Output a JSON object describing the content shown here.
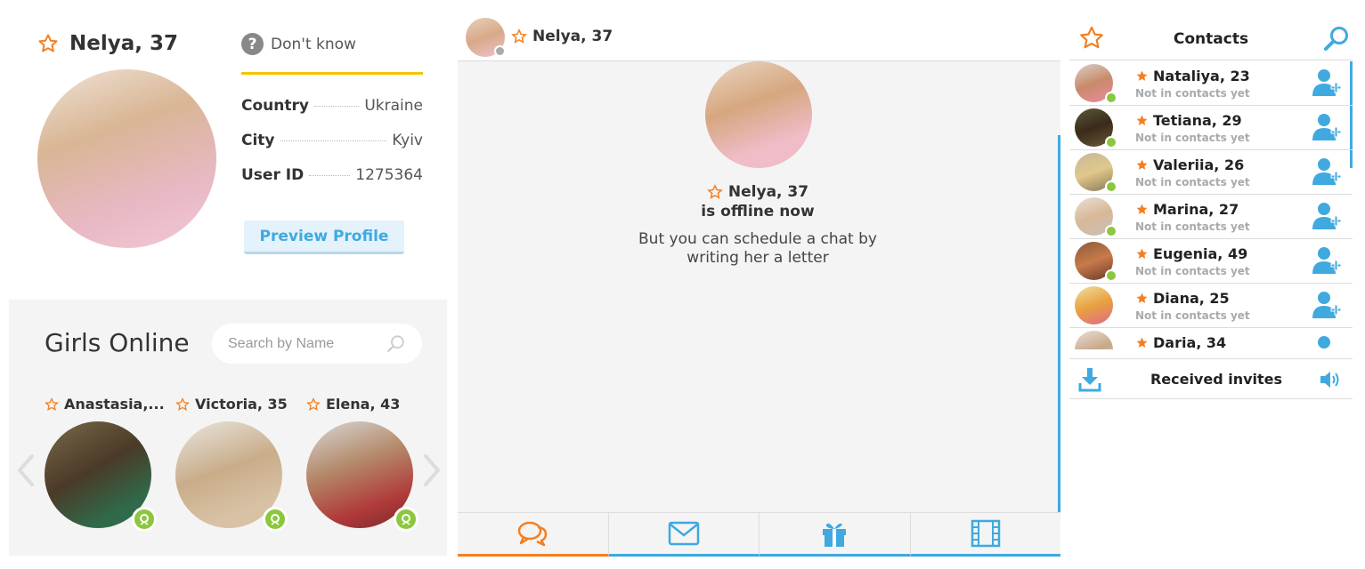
{
  "profile": {
    "name": "Nelya, 37",
    "status": "Don't know",
    "fields": [
      {
        "label": "Country",
        "value": "Ukraine"
      },
      {
        "label": "City",
        "value": "Kyiv"
      },
      {
        "label": "User ID",
        "value": "1275364"
      }
    ],
    "preview_label": "Preview Profile"
  },
  "girls_online": {
    "title": "Girls Online",
    "search_placeholder": "Search by Name",
    "girls": [
      {
        "name": "Anastasia,..."
      },
      {
        "name": "Victoria, 35"
      },
      {
        "name": "Elena, 43"
      }
    ]
  },
  "chat": {
    "header_name": "Nelya, 37",
    "offline_name": "Nelya, 37",
    "offline_status": "is offline now",
    "message_line1": "But you can schedule a chat by",
    "message_line2": "writing her a letter",
    "tabs": [
      "chat-icon",
      "letter-icon",
      "gift-icon",
      "video-icon"
    ]
  },
  "contacts": {
    "title": "Contacts",
    "items": [
      {
        "name": "Nataliya, 23",
        "sub": "Not in contacts yet"
      },
      {
        "name": "Tetiana, 29",
        "sub": "Not in contacts yet"
      },
      {
        "name": "Valeriia, 26",
        "sub": "Not in contacts yet"
      },
      {
        "name": "Marina, 27",
        "sub": "Not in contacts yet"
      },
      {
        "name": "Eugenia, 49",
        "sub": "Not in contacts yet"
      },
      {
        "name": "Diana, 25",
        "sub": "Not in contacts yet"
      },
      {
        "name": "Daria, 34",
        "sub": ""
      }
    ],
    "received_invites": "Received invites"
  },
  "colors": {
    "accent_blue": "#3fa9e0",
    "accent_orange": "#f57f20",
    "online_green": "#8dc63f",
    "divider_yellow": "#f7c300"
  }
}
